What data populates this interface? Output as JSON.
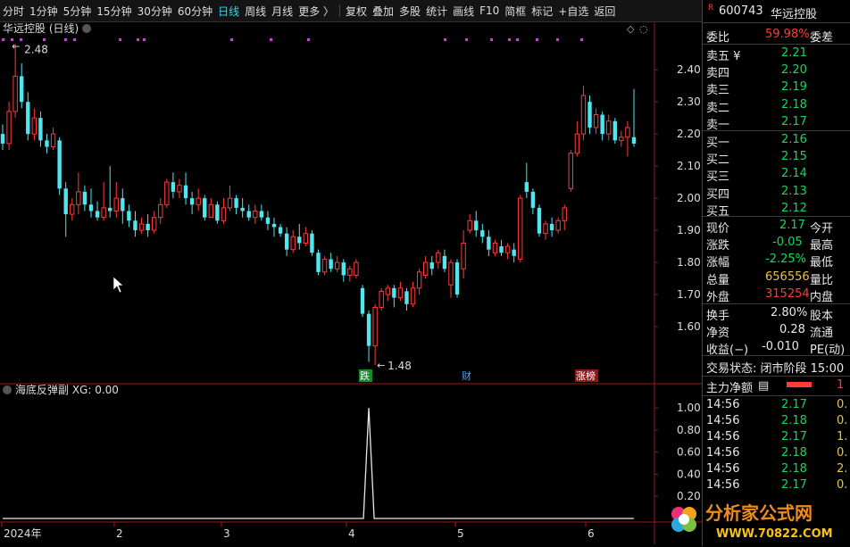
{
  "toolbar": {
    "tabs": [
      "分时",
      "1分钟",
      "5分钟",
      "15分钟",
      "30分钟",
      "60分钟",
      "日线",
      "周线",
      "月线",
      "更多 〉"
    ],
    "active_tab": "日线",
    "tools": [
      "复权",
      "叠加",
      "多股",
      "统计",
      "画线",
      "F10",
      "简框",
      "标记",
      "+自选",
      "返回"
    ]
  },
  "chart": {
    "title": "华远控股 (日线)",
    "price_high_label": "2.48",
    "price_low_label": "1.48",
    "price_ticks": [
      "2.40",
      "2.30",
      "2.20",
      "2.10",
      "2.00",
      "1.90",
      "1.80",
      "1.70",
      "1.60"
    ],
    "markers": [
      "跌",
      "财",
      "涨榜"
    ],
    "indicator_title": "海底反弹副  XG: 0.00",
    "indicator_ticks": [
      "1.00",
      "0.80",
      "0.60",
      "0.40",
      "0.20"
    ],
    "date_labels": [
      "2024年",
      "2",
      "3",
      "4",
      "5",
      "6"
    ],
    "colors": {
      "up": "#ff3b3b",
      "down": "#50e6f0",
      "signal": "#d83bd8",
      "axis": "#9a1a1a"
    }
  },
  "chart_data": {
    "type": "candlestick",
    "ylim": [
      1.45,
      2.52
    ],
    "candles": [
      [
        2.2,
        2.17,
        2.23,
        2.15
      ],
      [
        2.17,
        2.27,
        2.3,
        2.15
      ],
      [
        2.27,
        2.38,
        2.48,
        2.25
      ],
      [
        2.38,
        2.3,
        2.42,
        2.28
      ],
      [
        2.3,
        2.2,
        2.33,
        2.18
      ],
      [
        2.2,
        2.25,
        2.28,
        2.18
      ],
      [
        2.25,
        2.18,
        2.27,
        2.16
      ],
      [
        2.18,
        2.16,
        2.2,
        2.14
      ],
      [
        2.16,
        2.2,
        2.22,
        2.15
      ],
      [
        2.18,
        2.03,
        2.19,
        2.01
      ],
      [
        2.03,
        1.95,
        2.05,
        1.88
      ],
      [
        1.95,
        1.98,
        2.0,
        1.93
      ],
      [
        1.98,
        2.02,
        2.08,
        1.95
      ],
      [
        2.02,
        1.98,
        2.04,
        1.96
      ],
      [
        1.98,
        1.96,
        2.03,
        1.94
      ],
      [
        1.96,
        1.94,
        1.99,
        1.93
      ],
      [
        1.94,
        1.97,
        2.05,
        1.93
      ],
      [
        1.97,
        1.96,
        2.1,
        1.94
      ],
      [
        1.96,
        2.0,
        2.05,
        1.94
      ],
      [
        2.0,
        1.96,
        2.03,
        1.92
      ],
      [
        1.96,
        1.93,
        1.98,
        1.91
      ],
      [
        1.93,
        1.9,
        1.96,
        1.88
      ],
      [
        1.9,
        1.92,
        1.94,
        1.89
      ],
      [
        1.92,
        1.9,
        1.95,
        1.88
      ],
      [
        1.9,
        1.94,
        1.96,
        1.89
      ],
      [
        1.94,
        1.98,
        2.0,
        1.92
      ],
      [
        1.98,
        2.05,
        2.06,
        1.97
      ],
      [
        2.05,
        2.02,
        2.08,
        2.0
      ],
      [
        2.02,
        2.04,
        2.06,
        2.0
      ],
      [
        2.04,
        2.0,
        2.08,
        1.98
      ],
      [
        2.0,
        1.98,
        2.02,
        1.95
      ],
      [
        1.98,
        2.0,
        2.03,
        1.96
      ],
      [
        2.0,
        1.94,
        2.01,
        1.93
      ],
      [
        1.94,
        1.98,
        2.0,
        1.94
      ],
      [
        1.98,
        1.93,
        1.99,
        1.92
      ],
      [
        1.93,
        1.97,
        2.0,
        1.92
      ],
      [
        1.97,
        2.0,
        2.04,
        1.96
      ],
      [
        2.0,
        1.97,
        2.01,
        1.95
      ],
      [
        1.97,
        1.96,
        2.0,
        1.94
      ],
      [
        1.96,
        1.94,
        1.98,
        1.93
      ],
      [
        1.94,
        1.96,
        1.98,
        1.92
      ],
      [
        1.96,
        1.94,
        1.98,
        1.93
      ],
      [
        1.94,
        1.92,
        1.96,
        1.9
      ],
      [
        1.92,
        1.91,
        1.94,
        1.88
      ],
      [
        1.91,
        1.89,
        1.92,
        1.88
      ],
      [
        1.89,
        1.84,
        1.91,
        1.82
      ],
      [
        1.84,
        1.88,
        1.9,
        1.83
      ],
      [
        1.88,
        1.86,
        1.92,
        1.84
      ],
      [
        1.86,
        1.89,
        1.91,
        1.85
      ],
      [
        1.89,
        1.83,
        1.9,
        1.82
      ],
      [
        1.83,
        1.77,
        1.84,
        1.76
      ],
      [
        1.77,
        1.81,
        1.82,
        1.76
      ],
      [
        1.81,
        1.78,
        1.83,
        1.77
      ],
      [
        1.78,
        1.8,
        1.82,
        1.77
      ],
      [
        1.8,
        1.76,
        1.81,
        1.74
      ],
      [
        1.76,
        1.78,
        1.79,
        1.74
      ],
      [
        1.76,
        1.8,
        1.81,
        1.75
      ],
      [
        1.72,
        1.64,
        1.73,
        1.63
      ],
      [
        1.64,
        1.54,
        1.65,
        1.49
      ],
      [
        1.54,
        1.66,
        1.67,
        1.48
      ],
      [
        1.66,
        1.71,
        1.72,
        1.65
      ],
      [
        1.7,
        1.72,
        1.73,
        1.68
      ],
      [
        1.72,
        1.69,
        1.73,
        1.66
      ],
      [
        1.69,
        1.72,
        1.74,
        1.68
      ],
      [
        1.71,
        1.67,
        1.72,
        1.65
      ],
      [
        1.67,
        1.72,
        1.74,
        1.66
      ],
      [
        1.72,
        1.77,
        1.78,
        1.7
      ],
      [
        1.76,
        1.8,
        1.82,
        1.75
      ],
      [
        1.8,
        1.78,
        1.82,
        1.76
      ],
      [
        1.8,
        1.83,
        1.84,
        1.78
      ],
      [
        1.82,
        1.78,
        1.84,
        1.77
      ],
      [
        1.73,
        1.8,
        1.81,
        1.69
      ],
      [
        1.8,
        1.7,
        1.81,
        1.69
      ],
      [
        1.78,
        1.86,
        1.9,
        1.75
      ],
      [
        1.9,
        1.93,
        1.95,
        1.89
      ],
      [
        1.93,
        1.9,
        1.96,
        1.88
      ],
      [
        1.9,
        1.88,
        1.92,
        1.86
      ],
      [
        1.88,
        1.84,
        1.9,
        1.82
      ],
      [
        1.83,
        1.86,
        1.87,
        1.82
      ],
      [
        1.85,
        1.83,
        1.87,
        1.82
      ],
      [
        1.83,
        1.85,
        1.86,
        1.81
      ],
      [
        1.84,
        1.82,
        1.86,
        1.8
      ],
      [
        1.81,
        2.0,
        2.01,
        1.8
      ],
      [
        2.05,
        2.02,
        2.11,
        2.0
      ],
      [
        2.02,
        1.97,
        2.03,
        1.95
      ],
      [
        1.97,
        1.89,
        1.98,
        1.88
      ],
      [
        1.89,
        1.92,
        1.93,
        1.87
      ],
      [
        1.92,
        1.9,
        1.94,
        1.88
      ],
      [
        1.9,
        1.93,
        1.94,
        1.89
      ],
      [
        1.93,
        1.97,
        1.98,
        1.9
      ],
      [
        2.03,
        2.14,
        2.15,
        2.02
      ],
      [
        2.14,
        2.2,
        2.24,
        2.13
      ],
      [
        2.2,
        2.32,
        2.35,
        2.18
      ],
      [
        2.3,
        2.22,
        2.32,
        2.2
      ],
      [
        2.22,
        2.26,
        2.28,
        2.2
      ],
      [
        2.26,
        2.2,
        2.27,
        2.18
      ],
      [
        2.2,
        2.24,
        2.26,
        2.18
      ],
      [
        2.24,
        2.18,
        2.25,
        2.17
      ],
      [
        2.18,
        2.19,
        2.21,
        2.16
      ],
      [
        2.19,
        2.22,
        2.24,
        2.13
      ],
      [
        2.19,
        2.17,
        2.34,
        2.16
      ]
    ],
    "signal_day_index": 58,
    "indicator_ylim": [
      0,
      1.05
    ]
  },
  "quote": {
    "r_badge": "R",
    "code": "600743",
    "name": "华远控股",
    "ratio_label": "委比",
    "ratio_value": "59.98%",
    "ratio_label2": "委差",
    "asks": [
      {
        "label": "卖五 ¥",
        "price": "2.21"
      },
      {
        "label": "卖四",
        "price": "2.20"
      },
      {
        "label": "卖三",
        "price": "2.19"
      },
      {
        "label": "卖二",
        "price": "2.18"
      },
      {
        "label": "卖一",
        "price": "2.17"
      }
    ],
    "bids": [
      {
        "label": "买一",
        "price": "2.16"
      },
      {
        "label": "买二",
        "price": "2.15"
      },
      {
        "label": "买三",
        "price": "2.14"
      },
      {
        "label": "买四",
        "price": "2.13"
      },
      {
        "label": "买五",
        "price": "2.12"
      }
    ],
    "stats": [
      {
        "label": "现价",
        "value": "2.17",
        "right": "今开",
        "color": "green"
      },
      {
        "label": "涨跌",
        "value": "-0.05",
        "right": "最高",
        "color": "green"
      },
      {
        "label": "涨幅",
        "value": "-2.25%",
        "right": "最低",
        "color": "green"
      },
      {
        "label": "总量",
        "value": "656556",
        "right": "量比",
        "color": "yellow"
      },
      {
        "label": "外盘",
        "value": "315254",
        "right": "内盘",
        "color": "red"
      }
    ],
    "stats2": [
      {
        "label": "换手",
        "value": "2.80%",
        "right": "股本"
      },
      {
        "label": "净资",
        "value": "0.28",
        "right": "流通"
      },
      {
        "label": "收益(−)",
        "value": "-0.010",
        "right": "PE(动)"
      }
    ],
    "trade_state": "交易状态: 闭市阶段 15:00",
    "main_flow_label": "主力净额",
    "main_flow_value": "1",
    "ticks": [
      {
        "time": "14:56",
        "price": "2.17",
        "vol": "0.",
        "pc": "green",
        "vc": "yellow"
      },
      {
        "time": "14:56",
        "price": "2.18",
        "vol": "0.",
        "pc": "green",
        "vc": "yellow"
      },
      {
        "time": "14:56",
        "price": "2.17",
        "vol": "1.",
        "pc": "green",
        "vc": "yellow"
      },
      {
        "time": "14:56",
        "price": "2.18",
        "vol": "0.",
        "pc": "green",
        "vc": "yellow"
      },
      {
        "time": "14:56",
        "price": "2.18",
        "vol": "2.",
        "pc": "green",
        "vc": "yellow"
      },
      {
        "time": "14:56",
        "price": "2.17",
        "vol": "0.",
        "pc": "green",
        "vc": "yellow"
      }
    ]
  },
  "watermark": {
    "line1": "分析家公式网",
    "line2": "WWW.70822.COM"
  }
}
